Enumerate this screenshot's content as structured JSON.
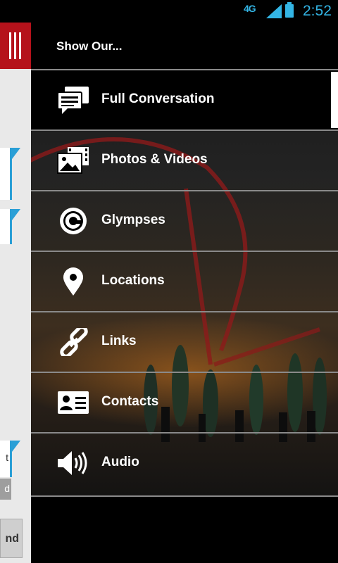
{
  "status_bar": {
    "network": "4G",
    "time": "2:52",
    "colors": {
      "accent": "#33b5e5"
    }
  },
  "background_app": {
    "colors": {
      "menu_button": "#b5121b",
      "bubble_accent": "#2a9fd6"
    },
    "visible_fragments": {
      "bubble_partial_text": "t",
      "sent_label_partial": "d",
      "send_button_partial": "nd"
    }
  },
  "drawer": {
    "header_title": "Show Our...",
    "items": [
      {
        "label": "Full Conversation",
        "icon": "conversation-icon",
        "selected": true
      },
      {
        "label": "Photos & Videos",
        "icon": "photos-videos-icon"
      },
      {
        "label": "Glympses",
        "icon": "glympse-icon"
      },
      {
        "label": "Locations",
        "icon": "location-pin-icon"
      },
      {
        "label": "Links",
        "icon": "link-icon"
      },
      {
        "label": "Contacts",
        "icon": "contact-card-icon"
      },
      {
        "label": "Audio",
        "icon": "speaker-icon"
      }
    ]
  }
}
